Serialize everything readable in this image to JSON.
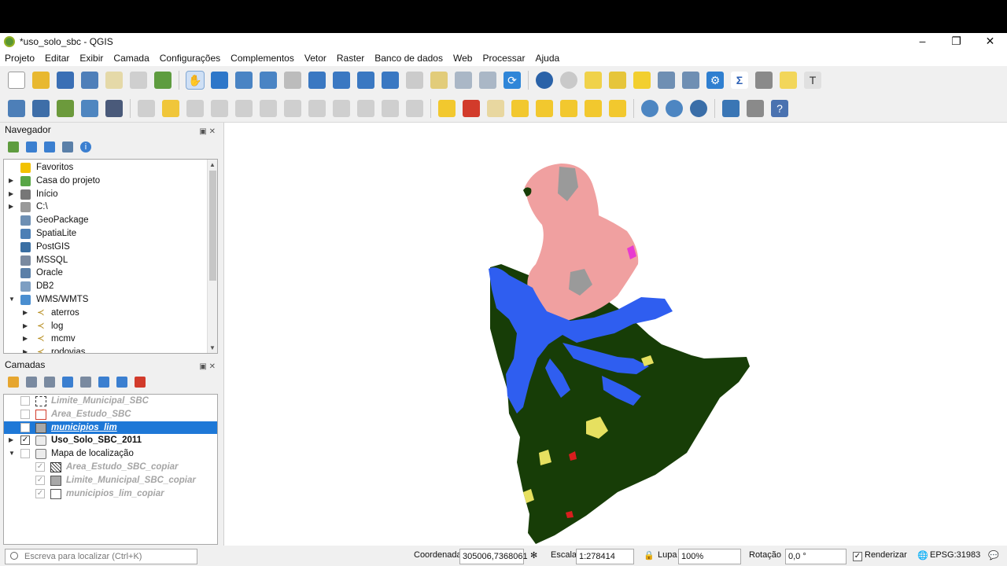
{
  "window": {
    "title": "*uso_solo_sbc - QGIS",
    "controls": {
      "minimize": "–",
      "maximize": "❐",
      "close": "✕"
    }
  },
  "menu": [
    "Projeto",
    "Editar",
    "Exibir",
    "Camada",
    "Configurações",
    "Complementos",
    "Vetor",
    "Raster",
    "Banco de dados",
    "Web",
    "Processar",
    "Ajuda"
  ],
  "navigator": {
    "title": "Navegador",
    "items": [
      {
        "label": "Favoritos",
        "icon": "star-icon",
        "color": "#f2c200",
        "expand": ""
      },
      {
        "label": "Casa do projeto",
        "icon": "project-home-icon",
        "color": "#58a646",
        "expand": "▶"
      },
      {
        "label": "Início",
        "icon": "home-folder-icon",
        "color": "#777777",
        "expand": "▶"
      },
      {
        "label": "C:\\",
        "icon": "folder-icon",
        "color": "#999999",
        "expand": "▶"
      },
      {
        "label": "GeoPackage",
        "icon": "geopackage-icon",
        "color": "#6d8fb3",
        "expand": ""
      },
      {
        "label": "SpatiaLite",
        "icon": "spatialite-icon",
        "color": "#4c7fb5",
        "expand": ""
      },
      {
        "label": "PostGIS",
        "icon": "postgis-icon",
        "color": "#3a6fa3",
        "expand": ""
      },
      {
        "label": "MSSQL",
        "icon": "mssql-icon",
        "color": "#7a8aa0",
        "expand": ""
      },
      {
        "label": "Oracle",
        "icon": "oracle-icon",
        "color": "#5a7fa8",
        "expand": ""
      },
      {
        "label": "DB2",
        "icon": "db2-icon",
        "color": "#7d9ec2",
        "expand": ""
      },
      {
        "label": "WMS/WMTS",
        "icon": "wms-globe-icon",
        "color": "#4a8ed0",
        "expand": "▼"
      }
    ],
    "wms_children": [
      "aterros",
      "log",
      "mcmv",
      "rodovias"
    ]
  },
  "layers": {
    "title": "Camadas",
    "items": [
      {
        "label": "Limite_Municipal_SBC",
        "checked": false,
        "style": "greyed",
        "swatch": "dashed",
        "indent": 0,
        "expand": ""
      },
      {
        "label": "Area_Estudo_SBC",
        "checked": false,
        "style": "greyed",
        "swatch": "red-outline",
        "indent": 0,
        "expand": ""
      },
      {
        "label": "municipios_lim",
        "checked": false,
        "style": "selected",
        "swatch": "grey-fill",
        "indent": 0,
        "expand": ""
      },
      {
        "label": "Uso_Solo_SBC_2011",
        "checked": true,
        "style": "bold",
        "swatch": "group",
        "indent": 0,
        "expand": "▶"
      },
      {
        "label": "Mapa de localização",
        "checked": false,
        "style": "normal",
        "swatch": "group-alt",
        "indent": 0,
        "expand": "▼"
      },
      {
        "label": "Area_Estudo_SBC_copiar",
        "checked": true,
        "style": "greyed",
        "swatch": "hatched",
        "indent": 1,
        "expand": ""
      },
      {
        "label": "Limite_Municipal_SBC_copiar",
        "checked": true,
        "style": "greyed",
        "swatch": "grey-fill",
        "indent": 1,
        "expand": ""
      },
      {
        "label": "municipios_lim_copiar",
        "checked": true,
        "style": "greyed",
        "swatch": "white-fill",
        "indent": 1,
        "expand": ""
      }
    ]
  },
  "status": {
    "search_placeholder": "Escreva para localizar (Ctrl+K)",
    "coord_label": "Coordenada",
    "coord_value": "305006,7368061",
    "scale_label": "Escala",
    "scale_value": "1:278414",
    "magnifier_label": "Lupa",
    "magnifier_value": "100%",
    "rotation_label": "Rotação",
    "rotation_value": "0,0 °",
    "render_label": "Renderizar",
    "crs": "EPSG:31983"
  },
  "colors": {
    "urban": "#f0a0a0",
    "water": "#2f5ef0",
    "vegetation": "#173d07",
    "field": "#e6e060",
    "selection": "#1e78d7"
  }
}
